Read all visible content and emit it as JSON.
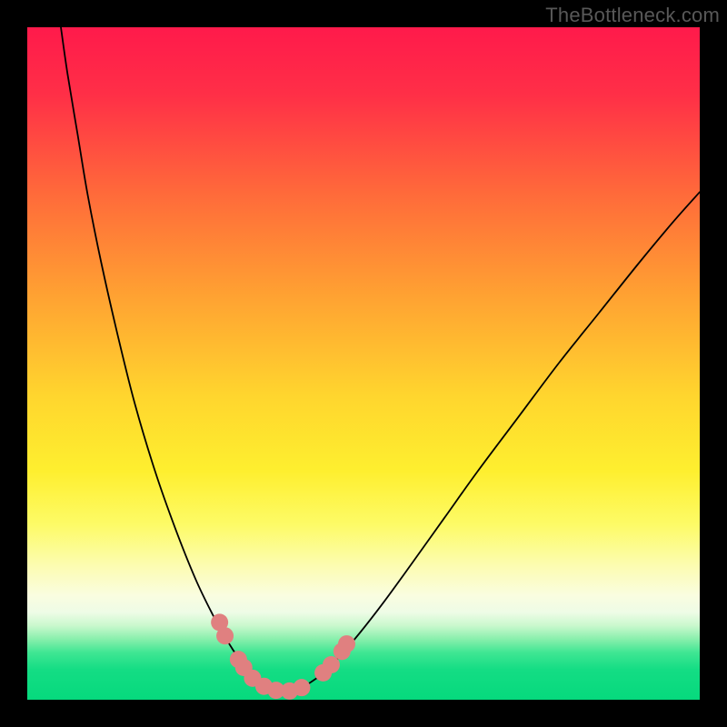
{
  "watermark": "TheBottleneck.com",
  "chart_data": {
    "type": "line",
    "title": "",
    "xlabel": "",
    "ylabel": "",
    "xlim": [
      0,
      100
    ],
    "ylim": [
      0,
      100
    ],
    "background_gradient": {
      "stops": [
        {
          "offset": 0.0,
          "color": "#ff1a4b"
        },
        {
          "offset": 0.1,
          "color": "#ff2f47"
        },
        {
          "offset": 0.25,
          "color": "#ff6b3a"
        },
        {
          "offset": 0.4,
          "color": "#ffa232"
        },
        {
          "offset": 0.55,
          "color": "#ffd62e"
        },
        {
          "offset": 0.66,
          "color": "#feef2f"
        },
        {
          "offset": 0.74,
          "color": "#fdfb67"
        },
        {
          "offset": 0.8,
          "color": "#fcfcb0"
        },
        {
          "offset": 0.845,
          "color": "#fafde0"
        },
        {
          "offset": 0.87,
          "color": "#eefce6"
        },
        {
          "offset": 0.89,
          "color": "#c9f8cd"
        },
        {
          "offset": 0.91,
          "color": "#88efac"
        },
        {
          "offset": 0.93,
          "color": "#3fe693"
        },
        {
          "offset": 0.955,
          "color": "#14dd84"
        },
        {
          "offset": 1.0,
          "color": "#06d97d"
        }
      ]
    },
    "series": [
      {
        "name": "left-curve",
        "type": "line",
        "color": "#000000",
        "width": 1.8,
        "points": [
          {
            "x": 5.0,
            "y": 100.0
          },
          {
            "x": 6.0,
            "y": 93.0
          },
          {
            "x": 7.5,
            "y": 84.0
          },
          {
            "x": 9.0,
            "y": 75.0
          },
          {
            "x": 11.0,
            "y": 65.0
          },
          {
            "x": 13.5,
            "y": 54.0
          },
          {
            "x": 16.0,
            "y": 44.0
          },
          {
            "x": 19.0,
            "y": 34.0
          },
          {
            "x": 22.0,
            "y": 25.5
          },
          {
            "x": 25.0,
            "y": 18.0
          },
          {
            "x": 27.5,
            "y": 12.8
          },
          {
            "x": 29.5,
            "y": 9.2
          },
          {
            "x": 31.0,
            "y": 6.8
          },
          {
            "x": 32.5,
            "y": 4.8
          },
          {
            "x": 34.0,
            "y": 3.3
          },
          {
            "x": 35.5,
            "y": 2.3
          },
          {
            "x": 37.0,
            "y": 1.6
          },
          {
            "x": 38.5,
            "y": 1.2
          }
        ]
      },
      {
        "name": "right-curve",
        "type": "line",
        "color": "#000000",
        "width": 1.8,
        "points": [
          {
            "x": 38.5,
            "y": 1.2
          },
          {
            "x": 40.0,
            "y": 1.5
          },
          {
            "x": 42.0,
            "y": 2.5
          },
          {
            "x": 44.0,
            "y": 4.0
          },
          {
            "x": 46.5,
            "y": 6.5
          },
          {
            "x": 49.5,
            "y": 10.0
          },
          {
            "x": 53.0,
            "y": 14.5
          },
          {
            "x": 57.0,
            "y": 20.0
          },
          {
            "x": 62.0,
            "y": 27.0
          },
          {
            "x": 67.0,
            "y": 34.0
          },
          {
            "x": 73.0,
            "y": 42.0
          },
          {
            "x": 79.0,
            "y": 50.0
          },
          {
            "x": 85.0,
            "y": 57.5
          },
          {
            "x": 91.0,
            "y": 65.0
          },
          {
            "x": 96.0,
            "y": 71.0
          },
          {
            "x": 100.0,
            "y": 75.5
          }
        ]
      },
      {
        "name": "markers",
        "type": "scatter",
        "color": "#e08080",
        "radius": 9.5,
        "points": [
          {
            "x": 28.6,
            "y": 11.5
          },
          {
            "x": 29.4,
            "y": 9.5
          },
          {
            "x": 31.4,
            "y": 6.0
          },
          {
            "x": 32.2,
            "y": 4.8
          },
          {
            "x": 33.5,
            "y": 3.2
          },
          {
            "x": 35.2,
            "y": 2.0
          },
          {
            "x": 37.0,
            "y": 1.4
          },
          {
            "x": 39.0,
            "y": 1.3
          },
          {
            "x": 40.8,
            "y": 1.8
          },
          {
            "x": 44.0,
            "y": 4.0
          },
          {
            "x": 45.2,
            "y": 5.2
          },
          {
            "x": 46.8,
            "y": 7.2
          },
          {
            "x": 47.5,
            "y": 8.3
          }
        ]
      }
    ]
  }
}
